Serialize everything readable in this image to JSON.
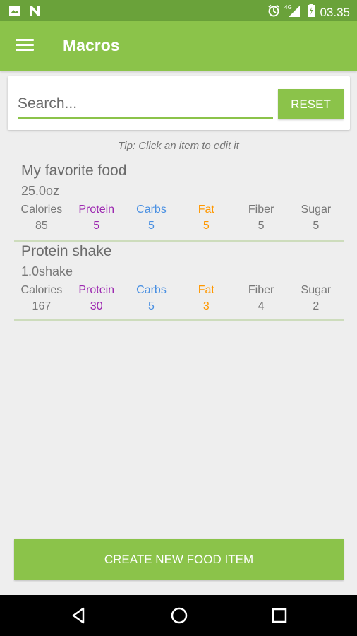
{
  "status_bar": {
    "time": "03.35",
    "network": "4G",
    "left_icons": [
      "image-icon",
      "n-app-icon"
    ],
    "right_icons": [
      "alarm-icon",
      "signal-icon",
      "battery-icon"
    ]
  },
  "app_bar": {
    "title": "Macros",
    "menu_icon": "hamburger-menu-icon",
    "color": "#8bc34a"
  },
  "search": {
    "placeholder": "Search...",
    "value": "",
    "reset_label": "RESET"
  },
  "tip": "Tip: Click an item to edit it",
  "macro_colors": {
    "calories": "#777777",
    "protein": "#9c27b0",
    "carbs": "#4a90e2",
    "fat": "#ff9800",
    "fiber": "#777777",
    "sugar": "#777777"
  },
  "food_items": [
    {
      "name": "My favorite food",
      "quantity": "25.0oz",
      "macros": [
        {
          "label": "Calories",
          "value": "85"
        },
        {
          "label": "Protein",
          "value": "5"
        },
        {
          "label": "Carbs",
          "value": "5"
        },
        {
          "label": "Fat",
          "value": "5"
        },
        {
          "label": "Fiber",
          "value": "5"
        },
        {
          "label": "Sugar",
          "value": "5"
        }
      ]
    },
    {
      "name": "Protein shake",
      "quantity": "1.0shake",
      "macros": [
        {
          "label": "Calories",
          "value": "167"
        },
        {
          "label": "Protein",
          "value": "30"
        },
        {
          "label": "Carbs",
          "value": "5"
        },
        {
          "label": "Fat",
          "value": "3"
        },
        {
          "label": "Fiber",
          "value": "4"
        },
        {
          "label": "Sugar",
          "value": "2"
        }
      ]
    }
  ],
  "create_button_label": "CREATE NEW FOOD ITEM",
  "nav_bar": {
    "icons": [
      "back-icon",
      "home-icon",
      "recents-icon"
    ]
  }
}
